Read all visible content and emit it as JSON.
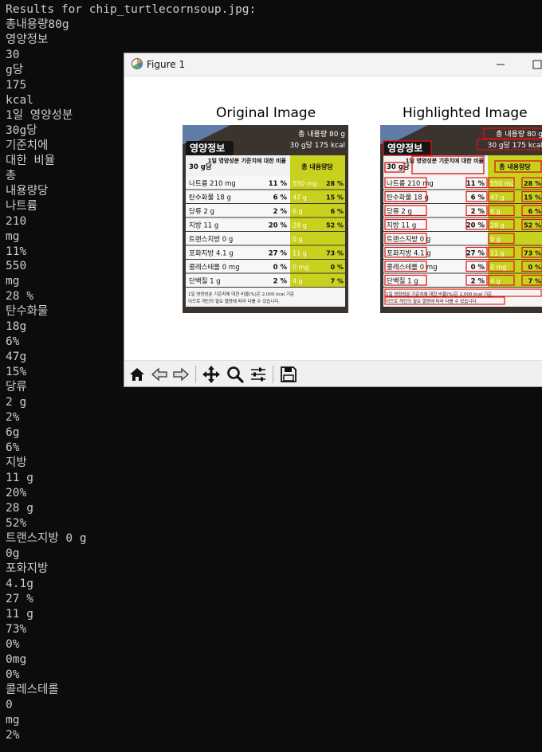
{
  "terminal": {
    "lines": [
      "Results for chip_turtlecornsoup.jpg:",
      "총내용량80g",
      "영양정보",
      "30",
      "g당",
      "175",
      "kcal",
      "1일 영양성분",
      "30g당",
      "기준치에",
      "대한 비율",
      "총",
      "내용량당",
      "나트륨",
      "210",
      "mg",
      "11%",
      "550",
      "mg",
      "28 %",
      "탄수화물",
      "18g",
      "6%",
      "47g",
      "15%",
      "당류",
      "2 g",
      "2%",
      "6g",
      "6%",
      "지방",
      "11 g",
      "20%",
      "28 g",
      "52%",
      "트랜스지방 0 g",
      "0g",
      "포화지방",
      "4.1g",
      "27 %",
      "11 g",
      "73%",
      "0%",
      "0mg",
      "0%",
      "콜레스테롤",
      "0",
      "mg",
      "2%"
    ]
  },
  "figure": {
    "window_title": "Figure 1",
    "left_title": "Original Image",
    "right_title": "Highlighted Image",
    "label": {
      "header": "영양정보",
      "total": "총 내용량 80 g",
      "per": "30 g당 175 kcal",
      "col_daily": "1일 영양성분 기준치에 대한 비율",
      "col_serving": "30 g당",
      "col_total": "총 내용량당",
      "rows": [
        {
          "name": "나트륨 210 mg",
          "pct": "11 %",
          "total": "550 mg",
          "tpct": "28 %"
        },
        {
          "name": "탄수화물 18 g",
          "pct": "6 %",
          "total": "47 g",
          "tpct": "15 %"
        },
        {
          "name": "당류 2 g",
          "pct": "2 %",
          "total": "6 g",
          "tpct": "6 %"
        },
        {
          "name": "지방 11 g",
          "pct": "20 %",
          "total": "28 g",
          "tpct": "52 %"
        },
        {
          "name": "트랜스지방 0 g",
          "pct": "",
          "total": "0 g",
          "tpct": ""
        },
        {
          "name": "포화지방 4.1 g",
          "pct": "27 %",
          "total": "11 g",
          "tpct": "73 %"
        },
        {
          "name": "콜레스테롤 0 mg",
          "pct": "0 %",
          "total": "0 mg",
          "tpct": "0 %"
        },
        {
          "name": "단백질 1 g",
          "pct": "2 %",
          "total": "4 g",
          "tpct": "7 %"
        }
      ],
      "footer1": "1일 영양성분 기준치에 대한 비율(%)은 2,000 kcal 기준",
      "footer2": "이므로 개인의 필요 열량에 따라 다를 수 있습니다."
    }
  },
  "toolbar": {
    "icons": [
      "home-icon",
      "back-icon",
      "forward-icon",
      "pan-icon",
      "zoom-icon",
      "configure-icon",
      "save-icon"
    ]
  },
  "colors": {
    "terminal_bg": "#0c0c0c",
    "terminal_text": "#cccccc",
    "label_yellow": "#c8d21e",
    "highlight_red": "#e01010"
  }
}
